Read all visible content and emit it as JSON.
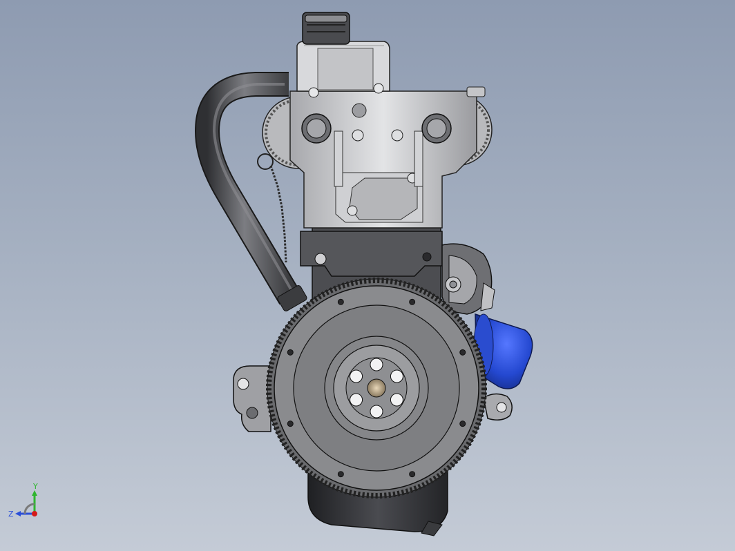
{
  "viewport": {
    "background_top": "#8e9bb1",
    "background_bottom": "#c4cbd6"
  },
  "model": {
    "name": "engine-assembly-rear-view",
    "components": [
      "oil-filler-cap",
      "cylinder-head-cover",
      "cam-sprocket-left",
      "cam-sprocket-right",
      "breather-hose",
      "dipstick",
      "engine-block",
      "flywheel",
      "ring-gear",
      "oil-filter",
      "oil-pan",
      "mounting-bracket"
    ],
    "colors": {
      "metal_light": "#c8c9cc",
      "metal_mid": "#8f9196",
      "metal_dark": "#4a4b4f",
      "flywheel": "#8a8b8e",
      "hose": "#4d4e52",
      "oil_filter": "#2448d0",
      "oil_pan": "#2e2f33",
      "edge": "#1a1a1a"
    },
    "flywheel_bolt_holes": 6
  },
  "triad": {
    "y_label": "Y",
    "z_label": "Z",
    "y_color": "#2fb52f",
    "z_color": "#2b4fd8",
    "origin_color": "#d41a1a"
  }
}
